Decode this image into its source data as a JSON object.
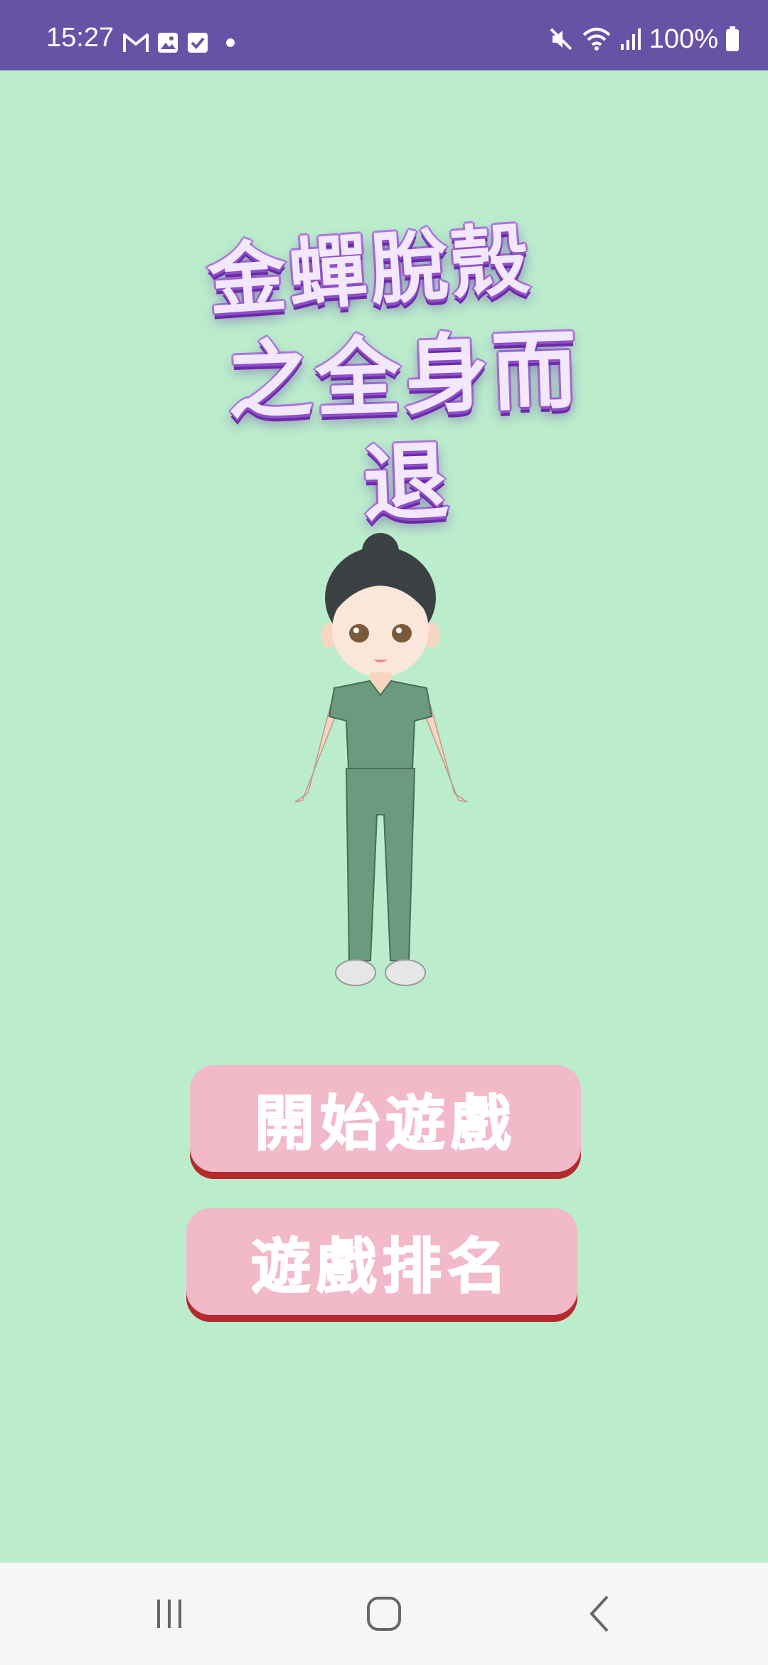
{
  "status_bar": {
    "time": "15:27",
    "battery": "100%",
    "background": "#6753a6",
    "left_icons": [
      "gmail-icon",
      "gallery-icon",
      "tasks-check-icon",
      "notification-dot-icon"
    ],
    "right_icons": [
      "mute-icon",
      "wifi-icon",
      "signal-icon",
      "battery-icon"
    ]
  },
  "logo": {
    "line1": "金蟬脫殼",
    "line2": "之全身而退"
  },
  "character": {
    "description_icon": "nurse-character-icon",
    "uniform_color": "#6b9a80"
  },
  "buttons": {
    "start": "開始遊戲",
    "ranking": "遊戲排名"
  },
  "colors": {
    "background": "#bbedcd",
    "button_fill": "#f2b9c8",
    "button_shadow": "#b42a2e"
  },
  "nav_bar": {
    "icons": [
      "recent-apps-icon",
      "home-icon",
      "back-icon"
    ]
  }
}
